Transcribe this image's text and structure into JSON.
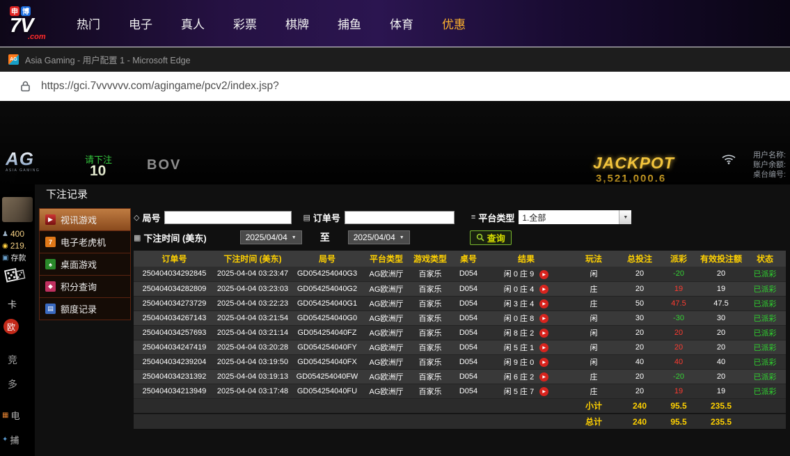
{
  "nav": {
    "logo": {
      "badge_left": "申",
      "badge_right": "博",
      "main": "7V",
      "suffix": ".com"
    },
    "items": [
      {
        "label": "热门"
      },
      {
        "label": "电子"
      },
      {
        "label": "真人"
      },
      {
        "label": "彩票"
      },
      {
        "label": "棋牌"
      },
      {
        "label": "捕鱼"
      },
      {
        "label": "体育"
      },
      {
        "label": "优惠",
        "highlight": true
      }
    ]
  },
  "browser": {
    "window_title": "Asia Gaming - 用户配置 1 - Microsoft Edge",
    "url": "https://gci.7vvvvvv.com/agingame/pcv2/index.jsp?"
  },
  "game": {
    "ag_logo": "AG",
    "ag_logo_sub": "ASIA GAMING",
    "bet_prompt": "请下注",
    "countdown": "10",
    "table_label": "BOV",
    "jackpot_label": "JACKPOT",
    "jackpot_value": "3,521,000.6",
    "user_info_labels": [
      "用户名称:",
      "账户余额:",
      "桌台编号:"
    ],
    "left_rail": [
      {
        "text": "400",
        "icon": "people-icon"
      },
      {
        "text": "219.",
        "icon": "coin-icon"
      },
      {
        "text": "存款",
        "icon": "deposit-icon"
      },
      {
        "text": "卡",
        "icon": null
      },
      {
        "text": "欧",
        "icon": null
      },
      {
        "text": "竞",
        "icon": null
      },
      {
        "text": "多",
        "icon": null
      },
      {
        "text": "电",
        "icon": "slot-icon"
      },
      {
        "text": "捕",
        "icon": "fish-icon"
      }
    ]
  },
  "modal": {
    "title": "下注记录",
    "sidebar": [
      {
        "label": "视讯游戏",
        "icon": "video-game",
        "active": true
      },
      {
        "label": "电子老虎机",
        "icon": "slot-machine",
        "active": false
      },
      {
        "label": "桌面游戏",
        "icon": "table-game",
        "active": false
      },
      {
        "label": "积分查询",
        "icon": "points-query",
        "active": false
      },
      {
        "label": "额度记录",
        "icon": "credit-record",
        "active": false
      }
    ],
    "filters": {
      "round_label": "局号",
      "round_value": "",
      "order_label": "订单号",
      "order_value": "",
      "platform_label": "平台类型",
      "platform_value": "1.全部",
      "time_label": "下注时间 (美东)",
      "date_from": "2025/04/04",
      "to_label": "至",
      "date_to": "2025/04/04",
      "search_label": "查询"
    },
    "table": {
      "headers": [
        "订单号",
        "下注时间 (美东)",
        "局号",
        "平台类型",
        "游戏类型",
        "桌号",
        "结果",
        "玩法",
        "总投注",
        "派彩",
        "有效投注额",
        "状态"
      ],
      "rows": [
        [
          "250404034292845",
          "2025-04-04 03:23:47",
          "GD054254040G3",
          "AG欧洲厅",
          "百家乐",
          "D054",
          "闲 0 庄 9",
          "闲",
          "20",
          "-20",
          "20",
          "已派彩"
        ],
        [
          "250404034282809",
          "2025-04-04 03:23:03",
          "GD054254040G2",
          "AG欧洲厅",
          "百家乐",
          "D054",
          "闲 0 庄 4",
          "庄",
          "20",
          "19",
          "19",
          "已派彩"
        ],
        [
          "250404034273729",
          "2025-04-04 03:22:23",
          "GD054254040G1",
          "AG欧洲厅",
          "百家乐",
          "D054",
          "闲 3 庄 4",
          "庄",
          "50",
          "47.5",
          "47.5",
          "已派彩"
        ],
        [
          "250404034267143",
          "2025-04-04 03:21:54",
          "GD054254040G0",
          "AG欧洲厅",
          "百家乐",
          "D054",
          "闲 0 庄 8",
          "闲",
          "30",
          "-30",
          "30",
          "已派彩"
        ],
        [
          "250404034257693",
          "2025-04-04 03:21:14",
          "GD054254040FZ",
          "AG欧洲厅",
          "百家乐",
          "D054",
          "闲 8 庄 2",
          "闲",
          "20",
          "20",
          "20",
          "已派彩"
        ],
        [
          "250404034247419",
          "2025-04-04 03:20:28",
          "GD054254040FY",
          "AG欧洲厅",
          "百家乐",
          "D054",
          "闲 5 庄 1",
          "闲",
          "20",
          "20",
          "20",
          "已派彩"
        ],
        [
          "250404034239204",
          "2025-04-04 03:19:50",
          "GD054254040FX",
          "AG欧洲厅",
          "百家乐",
          "D054",
          "闲 9 庄 0",
          "闲",
          "40",
          "40",
          "40",
          "已派彩"
        ],
        [
          "250404034231392",
          "2025-04-04 03:19:13",
          "GD054254040FW",
          "AG欧洲厅",
          "百家乐",
          "D054",
          "闲 6 庄 2",
          "庄",
          "20",
          "-20",
          "20",
          "已派彩"
        ],
        [
          "250404034213949",
          "2025-04-04 03:17:48",
          "GD054254040FU",
          "AG欧洲厅",
          "百家乐",
          "D054",
          "闲 5 庄 7",
          "庄",
          "20",
          "19",
          "19",
          "已派彩"
        ]
      ],
      "subtotal": {
        "label": "小计",
        "total_bet": "240",
        "payout": "95.5",
        "valid_bet": "235.5"
      },
      "grand_total": {
        "label": "总计",
        "total_bet": "240",
        "payout": "95.5",
        "valid_bet": "235.5"
      }
    }
  },
  "colors": {
    "accent_yellow": "#ffd100",
    "payout_positive": "#ff3b30",
    "payout_negative": "#35d235",
    "status_green": "#2fd42f",
    "nav_highlight": "#ffb32e"
  }
}
